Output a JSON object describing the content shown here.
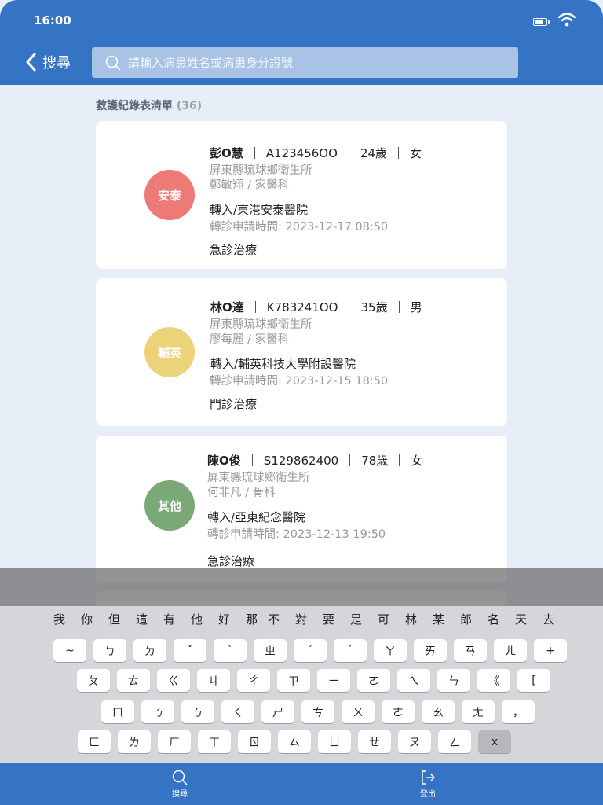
{
  "status": {
    "time": "16:00"
  },
  "header": {
    "back_label": "搜尋",
    "search_placeholder": "請輸入病患姓名或病患身分證號"
  },
  "list": {
    "title": "救護紀錄表清單",
    "count": "(36)",
    "records": [
      {
        "avatar_label": "安泰",
        "avatar_color": "#ed7a77",
        "name": "彭O慧",
        "id": "A123456OO",
        "age": "24歲",
        "gender": "女",
        "clinic": "屏東縣琉球鄉衛生所",
        "doctor": "鄭敏翔 / 家醫科",
        "transfer": "轉入/東港安泰醫院",
        "request_time": "轉診申請時間: 2023-12-17  08:50",
        "treatment": "急診治療"
      },
      {
        "avatar_label": "輔英",
        "avatar_color": "#ecd37a",
        "name": "林O達",
        "id": "K783241OO",
        "age": "35歲",
        "gender": "男",
        "clinic": "屏東縣琉球鄉衛生所",
        "doctor": "廖每麗 / 家醫科",
        "transfer": "轉入/輔英科技大學附設醫院",
        "request_time": "轉診申請時間: 2023-12-15  18:50",
        "treatment": "門診治療"
      },
      {
        "avatar_label": "其他",
        "avatar_color": "#7aa876",
        "name": "陳O俊",
        "id": "S129862400",
        "age": "78歲",
        "gender": "女",
        "clinic": "屏東縣琉球鄉衛生所",
        "doctor": "何非凡 / 骨科",
        "transfer": "轉入/亞東紀念醫院",
        "request_time": "轉診申請時間: 2023-12-13  19:50",
        "treatment": "急診治療"
      }
    ]
  },
  "keyboard": {
    "candidates": [
      "我",
      "你",
      "但",
      "這",
      "有",
      "他",
      "好",
      "那",
      "不",
      "對",
      "要",
      "是",
      "可",
      "林",
      "某",
      "郎",
      "名",
      "天",
      "去"
    ],
    "row1": [
      "~",
      "ㄅ",
      "ㄉ",
      "ˇ",
      "ˋ",
      "ㄓ",
      "ˊ",
      "˙",
      "ㄚ",
      "ㄞ",
      "ㄢ",
      "ㄦ",
      "+"
    ],
    "row2": [
      "ㄆ",
      "ㄊ",
      "ㄍ",
      "ㄐ",
      "ㄔ",
      "ㄗ",
      "ㄧ",
      "ㄛ",
      "ㄟ",
      "ㄣ",
      "《",
      "["
    ],
    "row3": [
      "ㄇ",
      "ㄋ",
      "ㄎ",
      "ㄑ",
      "ㄕ",
      "ㄘ",
      "ㄨ",
      "ㄜ",
      "ㄠ",
      "ㄤ",
      "，"
    ],
    "row4": [
      "ㄈ",
      "ㄌ",
      "ㄏ",
      "ㄒ",
      "ㄖ",
      "ㄙ",
      "ㄩ",
      "ㄝ",
      "ㄡ",
      "ㄥ",
      "x"
    ]
  },
  "bottom_nav": {
    "search_label": "搜尋",
    "logout_label": "登出"
  },
  "colors": {
    "primary": "#3573c4",
    "background": "#e8eef7"
  }
}
